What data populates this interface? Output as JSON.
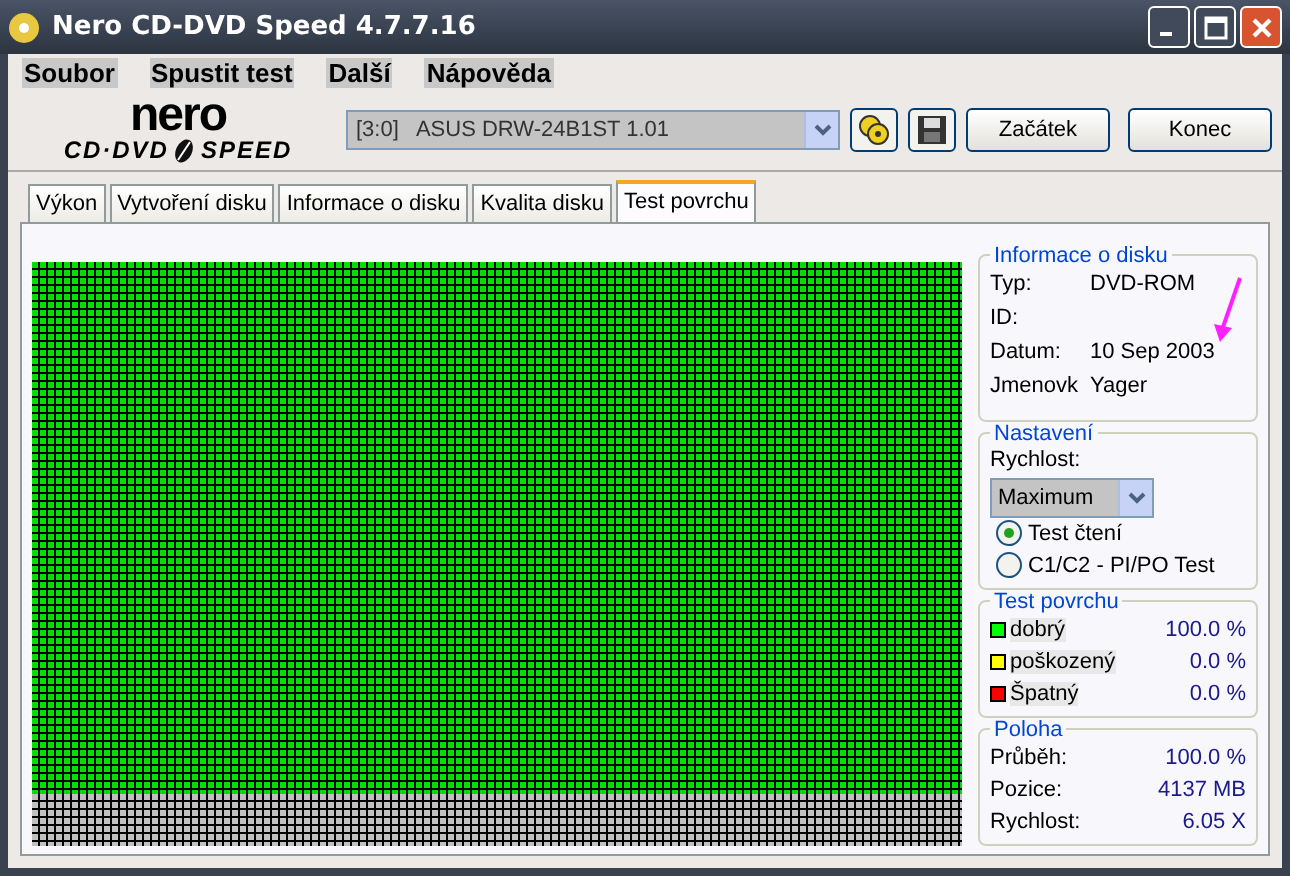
{
  "window": {
    "title": "Nero CD-DVD Speed 4.7.7.16"
  },
  "menu": [
    "Soubor",
    "Spustit test",
    "Další",
    "Nápověda"
  ],
  "logo": {
    "top": "nero",
    "left": "CD·DVD",
    "right": "SPEED"
  },
  "drive": {
    "value": "[3:0]   ASUS DRW-24B1ST 1.01"
  },
  "buttons": [
    "Začátek",
    "Konec"
  ],
  "tabs": [
    {
      "label": "Výkon",
      "selected": false
    },
    {
      "label": "Vytvoření disku",
      "selected": false
    },
    {
      "label": "Informace o disku",
      "selected": false
    },
    {
      "label": "Kvalita disku",
      "selected": false
    },
    {
      "label": "Test povrchu",
      "selected": true
    }
  ],
  "disc_info": {
    "title": "Informace o disku",
    "rows": [
      {
        "label": "Typ:",
        "value": "DVD-ROM"
      },
      {
        "label": "ID:"
      },
      {
        "label": "Datum:",
        "value": "10 Sep 2003"
      },
      {
        "label": "Jmenovk",
        "value": "Yager"
      }
    ]
  },
  "settings": {
    "title": "Nastavení",
    "speed_label": "Rychlost:",
    "speed": "Maximum",
    "options": [
      {
        "label": "Test čtení",
        "selected": true
      },
      {
        "label": "C1/C2 - PI/PO Test",
        "selected": false
      }
    ]
  },
  "surface_test": {
    "title": "Test povrchu",
    "rows": [
      {
        "label": "dobrý",
        "value": "100.0 %",
        "color": "#00ff00"
      },
      {
        "label": "poškozený",
        "value": "0.0 %",
        "color": "#ffff00"
      },
      {
        "label": "Špatný",
        "value": "0.0 %",
        "color": "#ff0000"
      }
    ]
  },
  "position": {
    "title": "Poloha",
    "rows": [
      {
        "label": "Průběh:",
        "value": "100.0 %"
      },
      {
        "label": "Pozice:",
        "value": "4137 MB"
      },
      {
        "label": "Rychlost:",
        "value": "6.05 X"
      }
    ]
  }
}
